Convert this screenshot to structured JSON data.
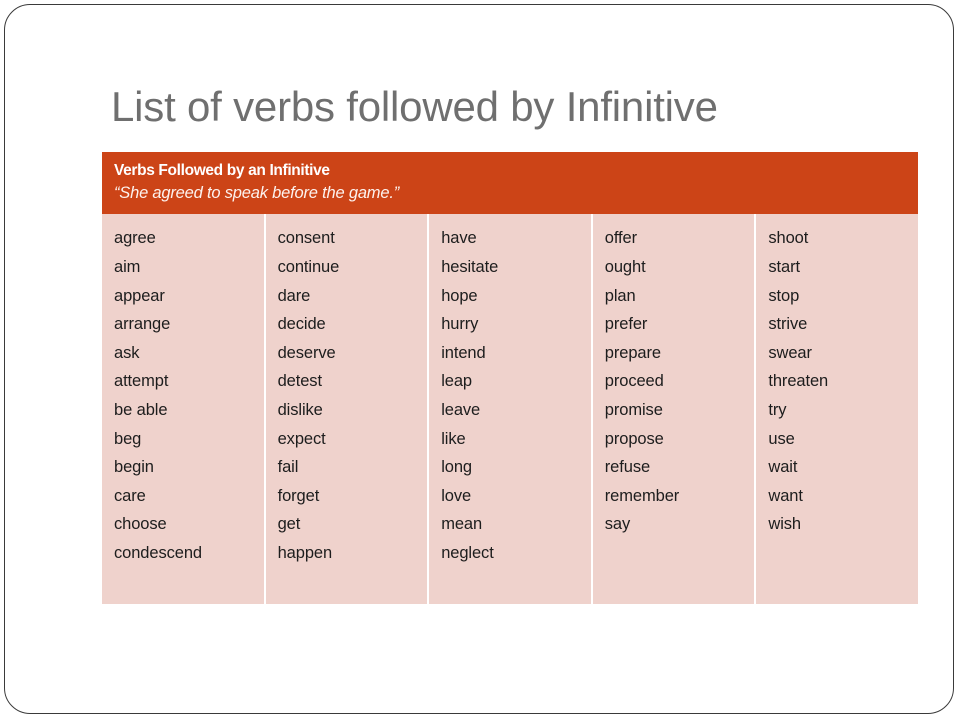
{
  "slide": {
    "title": "List of verbs followed by Infinitive",
    "accent_color": "#CC4417",
    "body_color": "#EFD2CC",
    "title_color": "#6F6F6F"
  },
  "table": {
    "header_title": "Verbs Followed by an Infinitive",
    "header_example": "“She agreed to speak before the game.”",
    "columns": [
      {
        "verbs": [
          "agree",
          "aim",
          "appear",
          "arrange",
          "ask",
          "attempt",
          "be able",
          "beg",
          "begin",
          "care",
          "choose",
          "condescend"
        ]
      },
      {
        "verbs": [
          "consent",
          "continue",
          "dare",
          "decide",
          "deserve",
          "detest",
          "dislike",
          "expect",
          "fail",
          "forget",
          "get",
          "happen"
        ]
      },
      {
        "verbs": [
          "have",
          "hesitate",
          "hope",
          "hurry",
          "intend",
          "leap",
          "leave",
          "like",
          "long",
          "love",
          "mean",
          "neglect"
        ]
      },
      {
        "verbs": [
          "offer",
          "ought",
          "plan",
          "prefer",
          "prepare",
          "proceed",
          "promise",
          "propose",
          "refuse",
          "remember",
          "say"
        ]
      },
      {
        "verbs": [
          "shoot",
          "start",
          "stop",
          "strive",
          "swear",
          "threaten",
          "try",
          "use",
          "wait",
          "want",
          "wish"
        ]
      }
    ]
  }
}
